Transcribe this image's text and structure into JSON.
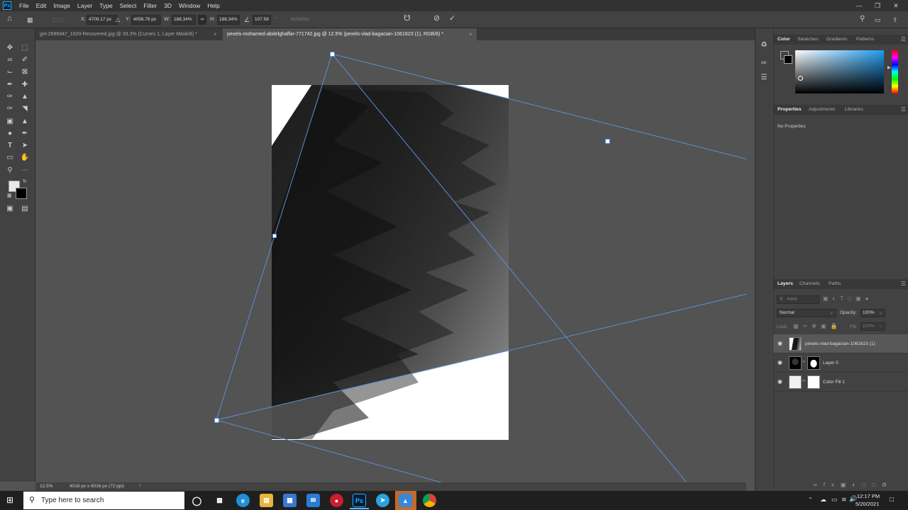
{
  "app": {
    "logo": "Ps"
  },
  "menu": [
    "File",
    "Edit",
    "Image",
    "Layer",
    "Type",
    "Select",
    "Filter",
    "3D",
    "Window",
    "Help"
  ],
  "options": {
    "x_label": "X:",
    "x_value": "4709.17 px",
    "y_label": "Y:",
    "y_value": "4056.76 px",
    "w_label": "W:",
    "w_value": "188.34%",
    "h_label": "H:",
    "h_value": "188.34%",
    "angle_value": "107.58",
    "antialias": "Antialias"
  },
  "tabs": [
    {
      "label": "girl-2696947_1920-Recovered.jpg @ 33.3% (Curves 1, Layer Mask/8) *"
    },
    {
      "label": "pexels-mohamed-abdelghaffar-771742.jpg @ 12.5% (pexels-vlad-bagacian-1061623 (1), RGB/8) *"
    }
  ],
  "status": {
    "zoom": "12.5%",
    "doc_size": "4016 px x 6016 px (72 ppi)"
  },
  "color_panel": {
    "tabs": [
      "Color",
      "Swatches",
      "Gradients",
      "Patterns"
    ]
  },
  "properties_panel": {
    "tabs": [
      "Properties",
      "Adjustments",
      "Libraries"
    ],
    "message": "No Properties"
  },
  "layers_panel": {
    "tabs": [
      "Layers",
      "Channels",
      "Paths"
    ],
    "kind_placeholder": "Kind",
    "blend_mode": "Normal",
    "opacity_label": "Opacity:",
    "opacity_value": "100%",
    "lock_label": "Lock:",
    "fill_label": "Fill:",
    "fill_value": "100%",
    "layers": [
      {
        "name": "pexels-vlad-bagacian-1061623 (1)"
      },
      {
        "name": "Layer 0"
      },
      {
        "name": "Color Fill 1"
      }
    ]
  },
  "taskbar": {
    "search_placeholder": "Type here to search",
    "time": "12:17 PM",
    "date": "5/20/2021"
  }
}
